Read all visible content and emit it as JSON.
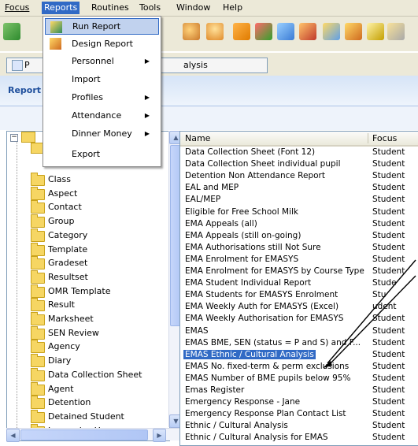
{
  "menubar": [
    "Focus",
    "Reports",
    "Routines",
    "Tools",
    "Window",
    "Help"
  ],
  "address": {
    "fragment": "alysis",
    "left_btn": "P"
  },
  "report_band": {
    "title": "Report"
  },
  "dropdown": [
    {
      "label": "Run Report",
      "submenu": false,
      "icon": "run-report-icon"
    },
    {
      "label": "Design Report",
      "submenu": false,
      "icon": "design-report-icon"
    },
    {
      "label": "Personnel",
      "submenu": true
    },
    {
      "label": "Import",
      "submenu": false
    },
    {
      "label": "Profiles",
      "submenu": true
    },
    {
      "label": "Attendance",
      "submenu": true
    },
    {
      "label": "Dinner Money",
      "submenu": true
    },
    {
      "label": "Export",
      "submenu": false
    }
  ],
  "tree": [
    "Class",
    "Aspect",
    "Contact",
    "Group",
    "Category",
    "Template",
    "Gradeset",
    "Resultset",
    "OMR Template",
    "Result",
    "Marksheet",
    "SEN Review",
    "Agency",
    "Diary",
    "Data Collection Sheet",
    "Agent",
    "Detention",
    "Detained Student",
    "Learnwise User"
  ],
  "list": {
    "columns": {
      "name": "Name",
      "focus": "Focus"
    },
    "rows": [
      {
        "name": "Data Collection Sheet (Font 12)",
        "focus": "Student"
      },
      {
        "name": "Data Collection Sheet individual pupil",
        "focus": "Student"
      },
      {
        "name": "Detention Non Attendance Report",
        "focus": "Student"
      },
      {
        "name": "EAL and MEP",
        "focus": "Student"
      },
      {
        "name": "EAL/MEP",
        "focus": "Student"
      },
      {
        "name": "Eligible for Free School Milk",
        "focus": "Student"
      },
      {
        "name": "EMA Appeals (all)",
        "focus": "Student"
      },
      {
        "name": "EMA Appeals (still on-going)",
        "focus": "Student"
      },
      {
        "name": "EMA Authorisations still Not Sure",
        "focus": "Student"
      },
      {
        "name": "EMA Enrolment for EMASYS",
        "focus": "Student"
      },
      {
        "name": "EMA Enrolment for EMASYS by Course Type",
        "focus": "Student"
      },
      {
        "name": "EMA Student Individual Report",
        "focus": "Stude"
      },
      {
        "name": "EMA Students for EMASYS Enrolment",
        "focus": "Stu"
      },
      {
        "name": "EMA Weekly Auth for EMASYS (Excel)",
        "focus": "udent"
      },
      {
        "name": "EMA Weekly Authorisation for EMASYS",
        "focus": "Student"
      },
      {
        "name": "EMAS",
        "focus": "Student"
      },
      {
        "name": "EMAS BME, SEN (status = P and S) and F...",
        "focus": "Student"
      },
      {
        "name": "EMAS Ethnic / Cultural Analysis",
        "focus": "Student",
        "selected": true
      },
      {
        "name": "EMAS No. fixed-term & perm exclusions",
        "focus": "Student"
      },
      {
        "name": "EMAS Number of BME pupils below 95%",
        "focus": "Student"
      },
      {
        "name": "Emas Register",
        "focus": "Student"
      },
      {
        "name": "Emergency Response - Jane",
        "focus": "Student"
      },
      {
        "name": "Emergency Response Plan Contact List",
        "focus": "Student"
      },
      {
        "name": "Ethnic / Cultural Analysis",
        "focus": "Student"
      },
      {
        "name": "Ethnic / Cultural Analysis for EMAS",
        "focus": "Student"
      }
    ]
  }
}
